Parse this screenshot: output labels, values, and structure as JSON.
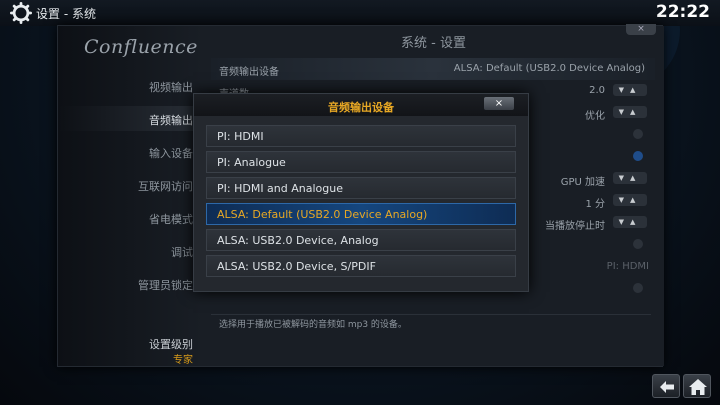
{
  "topbar": {
    "breadcrumb": "设置 - 系统",
    "time": "22:22"
  },
  "sidebar": {
    "logo": "Confluence",
    "items": [
      {
        "label": "视频输出",
        "active": false
      },
      {
        "label": "音频输出",
        "active": true
      },
      {
        "label": "输入设备",
        "active": false
      },
      {
        "label": "互联网访问",
        "active": false
      },
      {
        "label": "省电模式",
        "active": false
      },
      {
        "label": "调试",
        "active": false
      },
      {
        "label": "管理员锁定",
        "active": false
      }
    ],
    "settings_level_label": "设置级别",
    "settings_level_value": "专家"
  },
  "window": {
    "title": "系统 - 设置",
    "close_label": "×"
  },
  "settings": {
    "audio_device_label": "音频输出设备",
    "audio_device_value": "ALSA: Default (USB2.0 Device Analog)",
    "row2_label": "声道数",
    "row2_value": "2.0",
    "row3_value": "优化",
    "row6_value": "GPU 加速",
    "row7_value": "1 分",
    "row8_value": "当播放停止时",
    "row10_value": "PI: HDMI"
  },
  "description": "选择用于播放已被解码的音频如 mp3 的设备。",
  "dialog": {
    "title": "音频输出设备",
    "close_label": "×",
    "options": [
      "PI: HDMI",
      "PI: Analogue",
      "PI: HDMI and Analogue",
      "ALSA: Default (USB2.0 Device Analog)",
      "ALSA: USB2.0 Device, Analog",
      "ALSA: USB2.0 Device, S/PDIF"
    ],
    "selected_index": 3
  },
  "colors": {
    "accent": "#e8a824",
    "selection": "#15467e",
    "background": "#0a0f18"
  }
}
